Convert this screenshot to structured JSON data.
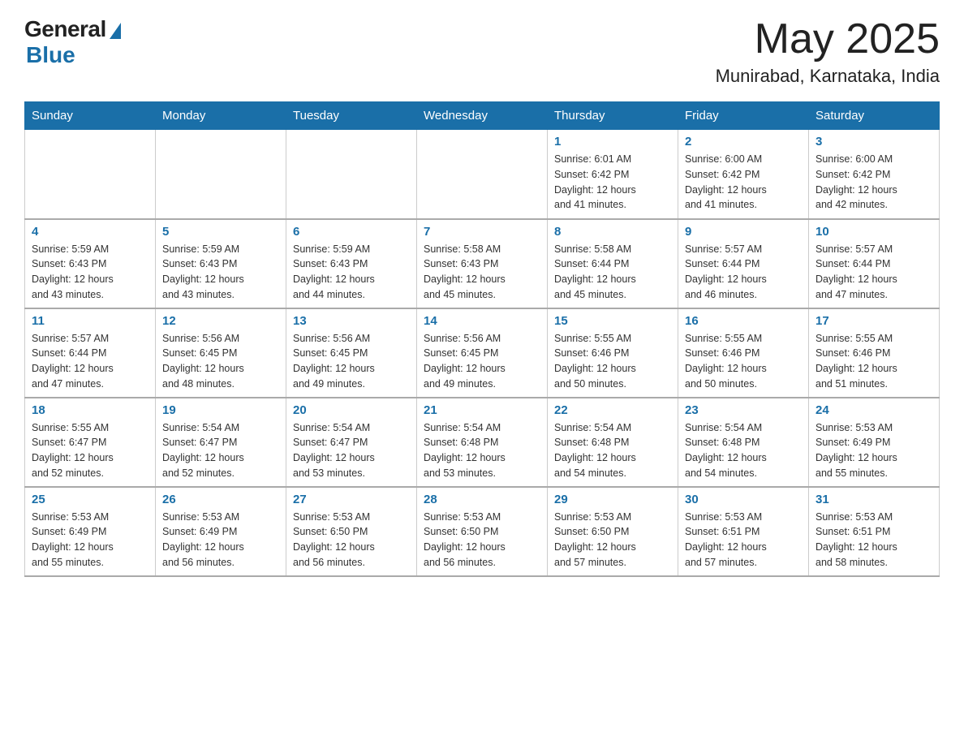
{
  "header": {
    "logo_general": "General",
    "logo_blue": "Blue",
    "month": "May 2025",
    "location": "Munirabad, Karnataka, India"
  },
  "weekdays": [
    "Sunday",
    "Monday",
    "Tuesday",
    "Wednesday",
    "Thursday",
    "Friday",
    "Saturday"
  ],
  "weeks": [
    [
      {
        "day": "",
        "info": ""
      },
      {
        "day": "",
        "info": ""
      },
      {
        "day": "",
        "info": ""
      },
      {
        "day": "",
        "info": ""
      },
      {
        "day": "1",
        "info": "Sunrise: 6:01 AM\nSunset: 6:42 PM\nDaylight: 12 hours\nand 41 minutes."
      },
      {
        "day": "2",
        "info": "Sunrise: 6:00 AM\nSunset: 6:42 PM\nDaylight: 12 hours\nand 41 minutes."
      },
      {
        "day": "3",
        "info": "Sunrise: 6:00 AM\nSunset: 6:42 PM\nDaylight: 12 hours\nand 42 minutes."
      }
    ],
    [
      {
        "day": "4",
        "info": "Sunrise: 5:59 AM\nSunset: 6:43 PM\nDaylight: 12 hours\nand 43 minutes."
      },
      {
        "day": "5",
        "info": "Sunrise: 5:59 AM\nSunset: 6:43 PM\nDaylight: 12 hours\nand 43 minutes."
      },
      {
        "day": "6",
        "info": "Sunrise: 5:59 AM\nSunset: 6:43 PM\nDaylight: 12 hours\nand 44 minutes."
      },
      {
        "day": "7",
        "info": "Sunrise: 5:58 AM\nSunset: 6:43 PM\nDaylight: 12 hours\nand 45 minutes."
      },
      {
        "day": "8",
        "info": "Sunrise: 5:58 AM\nSunset: 6:44 PM\nDaylight: 12 hours\nand 45 minutes."
      },
      {
        "day": "9",
        "info": "Sunrise: 5:57 AM\nSunset: 6:44 PM\nDaylight: 12 hours\nand 46 minutes."
      },
      {
        "day": "10",
        "info": "Sunrise: 5:57 AM\nSunset: 6:44 PM\nDaylight: 12 hours\nand 47 minutes."
      }
    ],
    [
      {
        "day": "11",
        "info": "Sunrise: 5:57 AM\nSunset: 6:44 PM\nDaylight: 12 hours\nand 47 minutes."
      },
      {
        "day": "12",
        "info": "Sunrise: 5:56 AM\nSunset: 6:45 PM\nDaylight: 12 hours\nand 48 minutes."
      },
      {
        "day": "13",
        "info": "Sunrise: 5:56 AM\nSunset: 6:45 PM\nDaylight: 12 hours\nand 49 minutes."
      },
      {
        "day": "14",
        "info": "Sunrise: 5:56 AM\nSunset: 6:45 PM\nDaylight: 12 hours\nand 49 minutes."
      },
      {
        "day": "15",
        "info": "Sunrise: 5:55 AM\nSunset: 6:46 PM\nDaylight: 12 hours\nand 50 minutes."
      },
      {
        "day": "16",
        "info": "Sunrise: 5:55 AM\nSunset: 6:46 PM\nDaylight: 12 hours\nand 50 minutes."
      },
      {
        "day": "17",
        "info": "Sunrise: 5:55 AM\nSunset: 6:46 PM\nDaylight: 12 hours\nand 51 minutes."
      }
    ],
    [
      {
        "day": "18",
        "info": "Sunrise: 5:55 AM\nSunset: 6:47 PM\nDaylight: 12 hours\nand 52 minutes."
      },
      {
        "day": "19",
        "info": "Sunrise: 5:54 AM\nSunset: 6:47 PM\nDaylight: 12 hours\nand 52 minutes."
      },
      {
        "day": "20",
        "info": "Sunrise: 5:54 AM\nSunset: 6:47 PM\nDaylight: 12 hours\nand 53 minutes."
      },
      {
        "day": "21",
        "info": "Sunrise: 5:54 AM\nSunset: 6:48 PM\nDaylight: 12 hours\nand 53 minutes."
      },
      {
        "day": "22",
        "info": "Sunrise: 5:54 AM\nSunset: 6:48 PM\nDaylight: 12 hours\nand 54 minutes."
      },
      {
        "day": "23",
        "info": "Sunrise: 5:54 AM\nSunset: 6:48 PM\nDaylight: 12 hours\nand 54 minutes."
      },
      {
        "day": "24",
        "info": "Sunrise: 5:53 AM\nSunset: 6:49 PM\nDaylight: 12 hours\nand 55 minutes."
      }
    ],
    [
      {
        "day": "25",
        "info": "Sunrise: 5:53 AM\nSunset: 6:49 PM\nDaylight: 12 hours\nand 55 minutes."
      },
      {
        "day": "26",
        "info": "Sunrise: 5:53 AM\nSunset: 6:49 PM\nDaylight: 12 hours\nand 56 minutes."
      },
      {
        "day": "27",
        "info": "Sunrise: 5:53 AM\nSunset: 6:50 PM\nDaylight: 12 hours\nand 56 minutes."
      },
      {
        "day": "28",
        "info": "Sunrise: 5:53 AM\nSunset: 6:50 PM\nDaylight: 12 hours\nand 56 minutes."
      },
      {
        "day": "29",
        "info": "Sunrise: 5:53 AM\nSunset: 6:50 PM\nDaylight: 12 hours\nand 57 minutes."
      },
      {
        "day": "30",
        "info": "Sunrise: 5:53 AM\nSunset: 6:51 PM\nDaylight: 12 hours\nand 57 minutes."
      },
      {
        "day": "31",
        "info": "Sunrise: 5:53 AM\nSunset: 6:51 PM\nDaylight: 12 hours\nand 58 minutes."
      }
    ]
  ]
}
